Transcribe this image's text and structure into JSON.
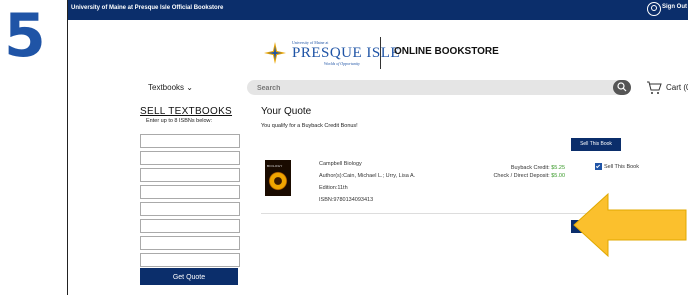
{
  "step_number": "5",
  "topbar": {
    "store_name": "University of Maine at Presque Isle Official Bookstore",
    "sign_out": "Sign Out"
  },
  "logo": {
    "small_text": "University of Maine at",
    "name": "PRESQUE ISLE",
    "tagline": "Worlds of Opportunity",
    "online_bookstore": "ONLINE BOOKSTORE"
  },
  "nav": {
    "textbooks_label": "Textbooks",
    "search_placeholder": "Search",
    "cart_label": "Cart (0)"
  },
  "sell": {
    "title": "SELL TEXTBOOKS",
    "hint": "Enter up to 8 ISBNs below:",
    "field_count": 8,
    "get_quote": "Get Quote"
  },
  "quote": {
    "title": "Your Quote",
    "bonus_text": "You qualify for a Buyback Credit Bonus!",
    "sell_button": "Sell This Book",
    "item": {
      "cover_title": "BIOLOGY",
      "title": "Campbell Biology",
      "authors": "Author(s):Cain, Michael L.; Urry, Lisa A.",
      "edition": "Edition:11th",
      "isbn": "ISBN:9780134093413",
      "buyback_label": "Buyback Credit:",
      "buyback_value": "$5.25",
      "check_label": "Check / Direct Deposit:",
      "check_value": "$5.00",
      "checkbox_label": "Sell This Book",
      "checked": true
    }
  },
  "colors": {
    "navy": "#0b2e6b",
    "step_blue": "#1f54a6",
    "credit_green": "#3a9a2a",
    "arrow_yellow": "#fbc02d"
  }
}
